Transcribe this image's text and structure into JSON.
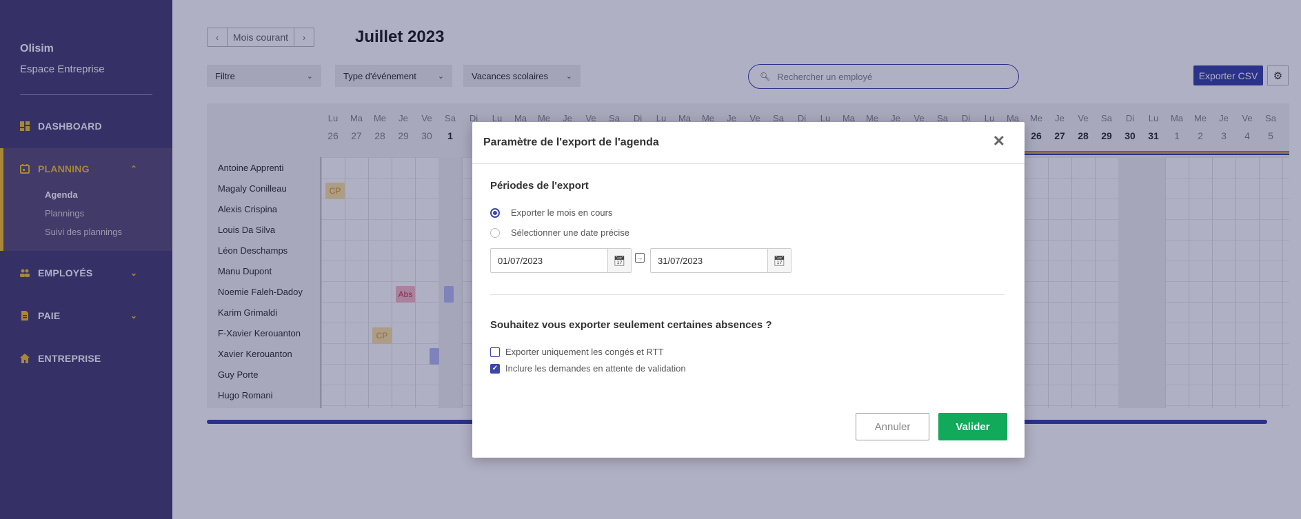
{
  "sidebar": {
    "company": "Olisim",
    "space": "Espace Entreprise",
    "items": [
      {
        "label": "DASHBOARD"
      },
      {
        "label": "PLANNING"
      },
      {
        "label": "EMPLOYÉS"
      },
      {
        "label": "PAIE"
      },
      {
        "label": "ENTREPRISE"
      }
    ],
    "planning_sub": [
      "Agenda",
      "Plannings",
      "Suivi des plannings"
    ]
  },
  "toolbar": {
    "current_month": "Mois courant",
    "month_title": "Juillet 2023",
    "filter": "Filtre",
    "event_type": "Type d'événement",
    "school_holidays": "Vacances scolaires",
    "search_placeholder": "Rechercher un employé",
    "export_csv": "Exporter CSV"
  },
  "calendar": {
    "day_letters": [
      "Lu",
      "Ma",
      "Me",
      "Je",
      "Ve",
      "Sa",
      "Di",
      "Lu",
      "Ma",
      "Me",
      "Je",
      "Ve",
      "Sa",
      "Di",
      "Lu",
      "Ma",
      "Me",
      "Je",
      "Ve",
      "Sa",
      "Di",
      "Lu",
      "Ma",
      "Me",
      "Je",
      "Ve",
      "Sa",
      "Di",
      "Lu",
      "Ma",
      "Me",
      "Je",
      "Ve",
      "Sa",
      "Di",
      "Lu",
      "Ma",
      "Me",
      "Je",
      "Ve",
      "Sa"
    ],
    "visible_day_numbers_left": [
      "26",
      "27",
      "28",
      "29",
      "30",
      "1"
    ],
    "visible_day_numbers_right": [
      "26",
      "27",
      "28",
      "29",
      "30",
      "31",
      "1",
      "2",
      "3",
      "4",
      "5"
    ],
    "employees": [
      "Antoine Apprenti",
      "Magaly Conilleau",
      "Alexis Crispina",
      "Louis Da Silva",
      "Léon Deschamps",
      "Manu Dupont",
      "Noemie Faleh-Dadoy",
      "Karim Grimaldi",
      "F-Xavier Kerouanton",
      "Xavier Kerouanton",
      "Guy Porte",
      "Hugo Romani"
    ],
    "badges": {
      "cp": "CP",
      "abs": "Abs"
    }
  },
  "modal": {
    "title": "Paramètre de l'export de l'agenda",
    "periods_title": "Périodes de l'export",
    "radio_current": "Exporter le mois en cours",
    "radio_specific": "Sélectionner une date précise",
    "date_from": "01/07/2023",
    "date_to": "31/07/2023",
    "absences_title": "Souhaitez vous exporter seulement certaines absences ?",
    "check_conges": "Exporter uniquement les congés et RTT",
    "check_pending": "Inclure les demandes en attente de validation",
    "cancel": "Annuler",
    "validate": "Valider"
  },
  "colors": {
    "sidebar_bg": "#4a4477",
    "accent": "#3c46a8",
    "highlight": "#f4c430",
    "validate": "#11a95a"
  }
}
